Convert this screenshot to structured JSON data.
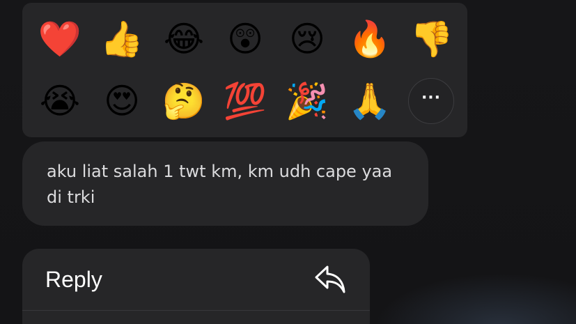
{
  "reactions": [
    {
      "icon": "red-heart-icon",
      "glyph": "❤️"
    },
    {
      "icon": "thumbs-up-icon",
      "glyph": "👍"
    },
    {
      "icon": "tears-of-joy-icon",
      "glyph": "😂"
    },
    {
      "icon": "astonished-face-icon",
      "glyph": "😲"
    },
    {
      "icon": "crying-face-icon",
      "glyph": "😢"
    },
    {
      "icon": "fire-icon",
      "glyph": "🔥"
    },
    {
      "icon": "thumbs-down-icon",
      "glyph": "👎"
    },
    {
      "icon": "loudly-crying-face-icon",
      "glyph": "😭"
    },
    {
      "icon": "heart-eyes-icon",
      "glyph": "😍"
    },
    {
      "icon": "thinking-face-icon",
      "glyph": "🤔"
    },
    {
      "icon": "hundred-points-icon",
      "glyph": "💯"
    },
    {
      "icon": "party-popper-icon",
      "glyph": "🎉"
    },
    {
      "icon": "folded-hands-icon",
      "glyph": "🙏"
    }
  ],
  "more": {
    "label": "···",
    "icon": "more-icon"
  },
  "message": {
    "text": "aku liat salah 1 twt km, km udh cape yaa di trki"
  },
  "menu": {
    "reply": {
      "label": "Reply",
      "icon": "reply-icon"
    }
  },
  "colors": {
    "background": "#151517",
    "panel": "#262628",
    "text_primary": "#ffffff",
    "text_message": "#dcdcde"
  }
}
